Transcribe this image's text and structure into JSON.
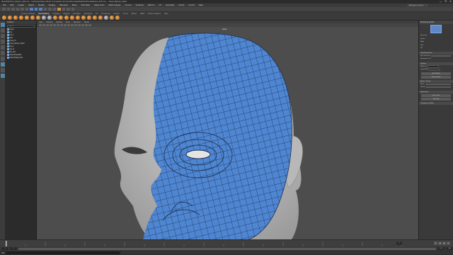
{
  "window": {
    "title": "MeshDef-Face_Retopo_002.ma - Autodesk Maya 2020: D:/Creative Shrubs/Tutorials/MeshDef-Face/Retopo_002.ma --- Head_Retopo_Mesh",
    "controls": [
      "—",
      "❐",
      "✕"
    ]
  },
  "menubar": {
    "items": [
      "File",
      "Edit",
      "Create",
      "Select",
      "Modify",
      "Display",
      "Windows",
      "Mesh",
      "Edit Mesh",
      "Mesh Tools",
      "Mesh Display",
      "Curves",
      "Surfaces",
      "Deform",
      "UV",
      "Generate",
      "Cache",
      "Arnold",
      "Help"
    ],
    "workspace": "Workspace: General"
  },
  "shelf": {
    "tabs": [
      "Curves / Surfaces",
      "Poly Modeling",
      "Sculpting",
      "Rigging",
      "Animation",
      "Rendering",
      "FX",
      "FX Caching",
      "Custom",
      "Arnold",
      "Bifrost",
      "MASH",
      "Motion Graphics",
      "XGen"
    ],
    "active_tab": "Poly Modeling"
  },
  "outliner": {
    "header": "Outliner",
    "search_placeholder": "Search...",
    "items": [
      "persp",
      "top",
      "front",
      "side",
      "Head_Hi",
      "Head_Retopo_Mesh",
      "Eye_L",
      "Eye_R",
      "Ear_Ref",
      "defaultLightSet",
      "defaultObjectSet"
    ]
  },
  "viewport": {
    "menus": [
      "View",
      "Shading",
      "Lighting",
      "Show",
      "Renderer",
      "Panels"
    ],
    "camera_label": "persp",
    "colors": {
      "background": "#4d4d4d",
      "sculpt": "#c9c9c9",
      "retopo": "#4f86d1",
      "wire": "#1a2e52"
    }
  },
  "attribute_editor": {
    "header": "Modeling Toolkit",
    "rows": [
      "Selection",
      "Vertex",
      "Edge",
      "Face",
      "UV",
      "Soft Selection",
      "Symmetry: Off",
      "Multi-Cut",
      "Quad Draw",
      "Relax",
      "Tweak"
    ],
    "sections": [
      "Quad Draw Tool",
      "Options",
      "Relax / Tweak",
      "Symmetry",
      "Component Editor"
    ],
    "buttons": [
      "Reset Tool",
      "Tool Help",
      "Auto Weld",
      "Extend Loop"
    ]
  },
  "timeline": {
    "current_frame": "1",
    "start": "1",
    "end": "120",
    "range_start": "1",
    "range_end": "200",
    "playback": [
      "⏮",
      "◀",
      "▶",
      "⏭"
    ]
  },
  "command_line": {
    "language": "MEL"
  }
}
